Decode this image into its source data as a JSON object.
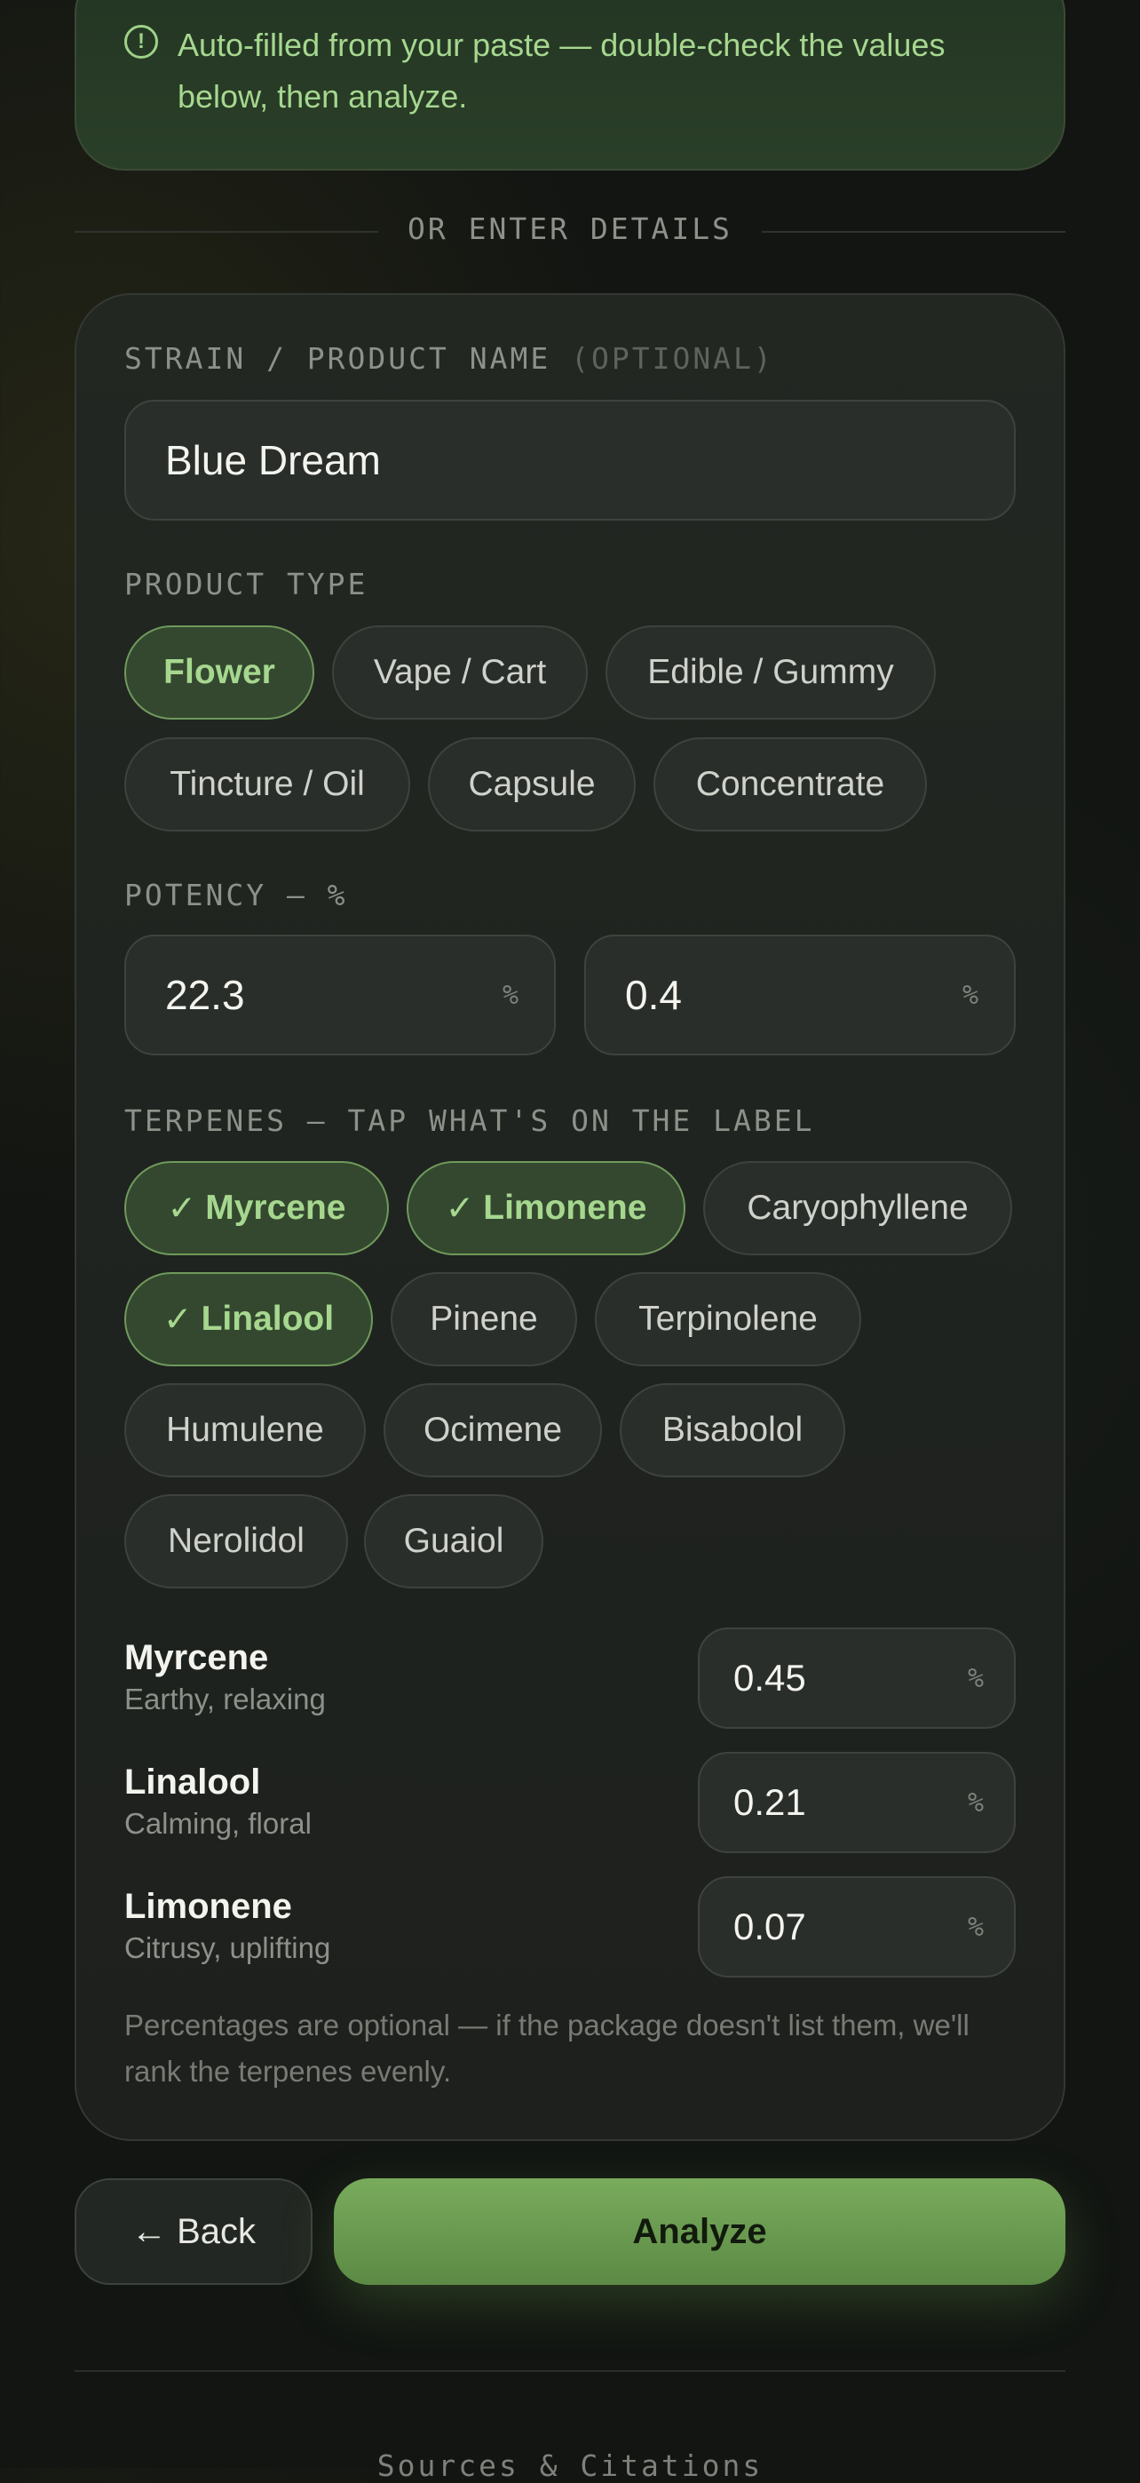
{
  "notice": {
    "text": "Auto-filled from your paste — double-check the values below, then analyze."
  },
  "divider": {
    "text": "OR ENTER DETAILS"
  },
  "form": {
    "name_label": "STRAIN / PRODUCT NAME",
    "name_optional": "(OPTIONAL)",
    "name_value": "Blue Dream",
    "product_type_label": "PRODUCT TYPE",
    "product_types": [
      {
        "label": "Flower",
        "selected": true
      },
      {
        "label": "Vape / Cart",
        "selected": false
      },
      {
        "label": "Edible / Gummy",
        "selected": false
      },
      {
        "label": "Tincture / Oil",
        "selected": false
      },
      {
        "label": "Capsule",
        "selected": false
      },
      {
        "label": "Concentrate",
        "selected": false
      }
    ],
    "potency_label": "POTENCY — %",
    "potency": [
      {
        "value": "22.3",
        "unit": "%"
      },
      {
        "value": "0.4",
        "unit": "%"
      }
    ],
    "terpenes_label": "TERPENES — TAP WHAT'S ON THE LABEL",
    "check_mark": "✓",
    "terpenes": [
      {
        "label": "Myrcene",
        "selected": true
      },
      {
        "label": "Limonene",
        "selected": true
      },
      {
        "label": "Caryophyllene",
        "selected": false
      },
      {
        "label": "Linalool",
        "selected": true
      },
      {
        "label": "Pinene",
        "selected": false
      },
      {
        "label": "Terpinolene",
        "selected": false
      },
      {
        "label": "Humulene",
        "selected": false
      },
      {
        "label": "Ocimene",
        "selected": false
      },
      {
        "label": "Bisabolol",
        "selected": false
      },
      {
        "label": "Nerolidol",
        "selected": false
      },
      {
        "label": "Guaiol",
        "selected": false
      }
    ],
    "terpene_values": [
      {
        "name": "Myrcene",
        "desc": "Earthy, relaxing",
        "value": "0.45",
        "unit": "%"
      },
      {
        "name": "Linalool",
        "desc": "Calming, floral",
        "value": "0.21",
        "unit": "%"
      },
      {
        "name": "Limonene",
        "desc": "Citrusy, uplifting",
        "value": "0.07",
        "unit": "%"
      }
    ],
    "note": "Percentages are optional — if the package doesn't list them, we'll rank the terpenes evenly."
  },
  "actions": {
    "back_label": "← Back",
    "analyze_label": "Analyze"
  },
  "footer": {
    "text": "Sources & Citations"
  },
  "colors": {
    "accent": "#a6d78f",
    "button": "#6b9b50"
  }
}
